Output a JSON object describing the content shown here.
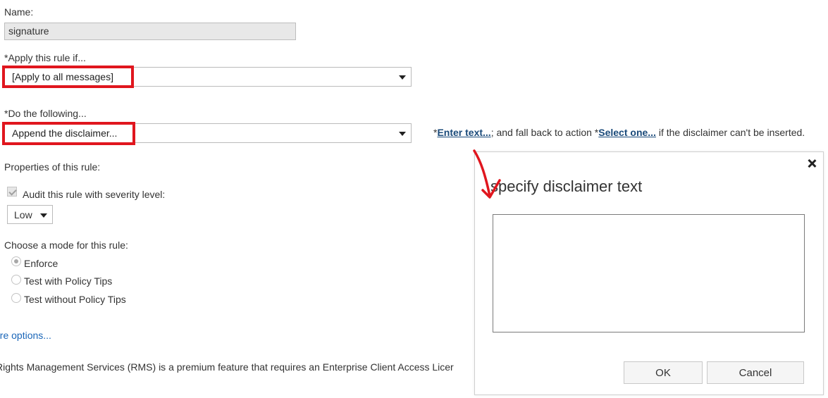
{
  "form": {
    "name_label": "Name:",
    "name_value": "signature",
    "apply_label": "*Apply this rule if...",
    "apply_value": "[Apply to all messages]",
    "do_label": "*Do the following...",
    "do_value": "Append the disclaimer...",
    "action_line": {
      "prefix": "*",
      "enter_text_link": "Enter text...",
      "middle": "; and fall back to action *",
      "select_one_link": "Select one...",
      "suffix": " if the disclaimer can't be inserted."
    },
    "properties_label": "Properties of this rule:",
    "audit_label": "Audit this rule with severity level:",
    "severity_value": "Low",
    "mode_label": "Choose a mode for this rule:",
    "modes": [
      "Enforce",
      "Test with Policy Tips",
      "Test without Policy Tips"
    ],
    "more_options": "ore options...",
    "rms_note": "Rights Management Services (RMS) is a premium feature that requires an Enterprise Client Access Licer"
  },
  "dialog": {
    "title": "specify disclaimer text",
    "ok_label": "OK",
    "cancel_label": "Cancel"
  },
  "colors": {
    "highlight": "#e0161e",
    "link": "#1a4a7a"
  }
}
